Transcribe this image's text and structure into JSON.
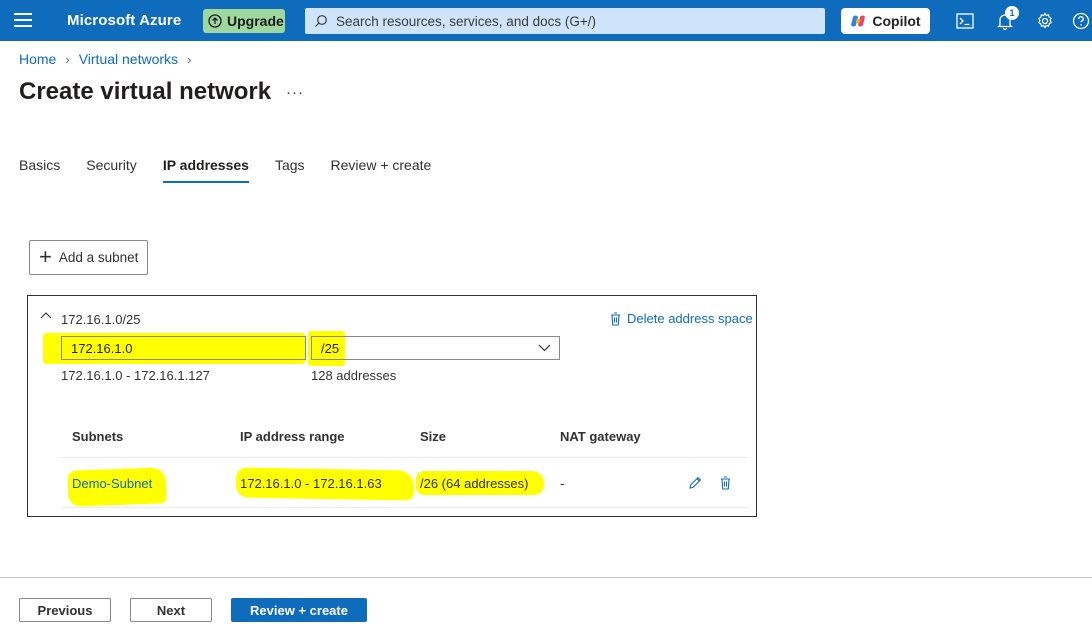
{
  "topbar": {
    "brand": "Microsoft Azure",
    "upgrade_label": "Upgrade",
    "search_placeholder": "Search resources, services, and docs (G+/)",
    "copilot_label": "Copilot",
    "notification_count": "1",
    "bar_color": "#0f6cbd"
  },
  "breadcrumb": [
    "Home",
    "Virtual networks"
  ],
  "page": {
    "title": "Create virtual network",
    "more": "···"
  },
  "tabs": [
    {
      "label": "Basics",
      "active": false
    },
    {
      "label": "Security",
      "active": false
    },
    {
      "label": "IP addresses",
      "active": true
    },
    {
      "label": "Tags",
      "active": false
    },
    {
      "label": "Review + create",
      "active": false
    }
  ],
  "add_subnet_label": "Add a subnet",
  "address_space": {
    "label": "172.16.1.0/25",
    "delete_label": "Delete address space",
    "ip_value": "172.16.1.0",
    "prefix_value": "/25",
    "range": "172.16.1.0 - 172.16.1.127",
    "address_count": "128 addresses"
  },
  "subnets_table": {
    "headers": [
      "Subnets",
      "IP address range",
      "Size",
      "NAT gateway"
    ],
    "rows": [
      {
        "name": "Demo-Subnet",
        "range": "172.16.1.0 - 172.16.1.63",
        "size": "/26 (64 addresses)",
        "nat": "-"
      }
    ]
  },
  "footer": {
    "previous_label": "Previous",
    "next_label": "Next",
    "review_label": "Review + create"
  },
  "highlight_color": "#ffff00"
}
